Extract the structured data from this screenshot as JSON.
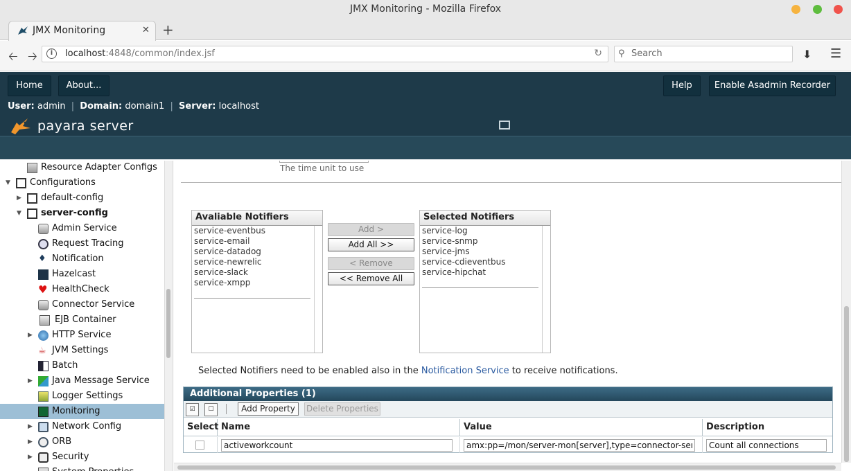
{
  "window": {
    "title": "JMX Monitoring - Mozilla Firefox"
  },
  "browser": {
    "tab_title": "JMX Monitoring",
    "tab_close": "✕",
    "new_tab": "+",
    "url_host": "localhost",
    "url_rest": ":4848/common/index.jsf",
    "search_placeholder": "Search"
  },
  "header": {
    "buttons": {
      "home": "Home",
      "about": "About...",
      "help": "Help",
      "recorder": "Enable Asadmin Recorder"
    },
    "user_label": "User:",
    "user_value": "admin",
    "domain_label": "Domain:",
    "domain_value": "domain1",
    "server_label": "Server:",
    "server_value": "localhost",
    "sep": "|",
    "brand": "payara server"
  },
  "tree": {
    "items": [
      {
        "label": "Resource Adapter Configs",
        "icon": "adapter-icon"
      },
      {
        "label": "Configurations",
        "icon": "config-icon"
      },
      {
        "label": "default-config",
        "icon": "config-icon"
      },
      {
        "label": "server-config",
        "icon": "config-icon"
      },
      {
        "label": "Admin Service",
        "icon": "service-icon"
      },
      {
        "label": "Request Tracing",
        "icon": "tracing-icon"
      },
      {
        "label": "Notification",
        "icon": "bell-icon"
      },
      {
        "label": "Hazelcast",
        "icon": "hazelcast-icon"
      },
      {
        "label": "HealthCheck",
        "icon": "heart-icon"
      },
      {
        "label": "Connector Service",
        "icon": "service-icon"
      },
      {
        "label": "EJB Container",
        "icon": "ejb-icon"
      },
      {
        "label": "HTTP Service",
        "icon": "globe-icon"
      },
      {
        "label": "JVM Settings",
        "icon": "java-icon"
      },
      {
        "label": "Batch",
        "icon": "batch-icon"
      },
      {
        "label": "Java Message Service",
        "icon": "jms-icon"
      },
      {
        "label": "Logger Settings",
        "icon": "logger-icon"
      },
      {
        "label": "Monitoring",
        "icon": "monitor-icon"
      },
      {
        "label": "Network Config",
        "icon": "network-icon"
      },
      {
        "label": "ORB",
        "icon": "orb-icon"
      },
      {
        "label": "Security",
        "icon": "lock-icon"
      },
      {
        "label": "System Properties",
        "icon": "properties-icon"
      }
    ]
  },
  "main": {
    "time_unit_hint": "The time unit to use",
    "available": {
      "title": "Avaliable Notifiers",
      "items": [
        "service-eventbus",
        "service-email",
        "service-datadog",
        "service-newrelic",
        "service-slack",
        "service-xmpp"
      ]
    },
    "selected": {
      "title": "Selected Notifiers",
      "items": [
        "service-log",
        "service-snmp",
        "service-jms",
        "service-cdieventbus",
        "service-hipchat"
      ]
    },
    "buttons": {
      "add": "Add >",
      "add_all": "Add All >>",
      "remove": "< Remove",
      "remove_all": "<< Remove All"
    },
    "notice_before": "Selected Notifiers need to be enabled also in the ",
    "notice_link": "Notification Service",
    "notice_after": " to receive notifications.",
    "properties": {
      "title": "Additional Properties (1)",
      "add_button": "Add Property",
      "delete_button": "Delete Properties",
      "columns": {
        "select": "Select",
        "name": "Name",
        "value": "Value",
        "description": "Description"
      },
      "rows": [
        {
          "name": "activeworkcount",
          "value": "amx:pp=/mon/server-mon[server],type=connector-service-mon",
          "description": "Count all connections"
        }
      ]
    }
  }
}
